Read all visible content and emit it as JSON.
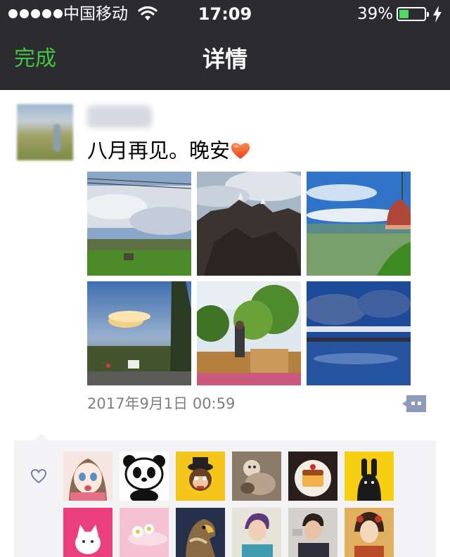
{
  "status_bar": {
    "carrier": "中国移动",
    "time": "17:09",
    "battery_percent": "39%",
    "battery_level": 0.39,
    "signal_dots": 5
  },
  "nav": {
    "done_label": "完成",
    "title": "详情"
  },
  "post": {
    "text": "八月再见。晚安",
    "emoji": "heart-emoji",
    "timestamp": "2017年9月1日 00:59",
    "photos": [
      {
        "icon": "field-landscape-photo"
      },
      {
        "icon": "rock-temple-photo"
      },
      {
        "icon": "bell-valley-photo"
      },
      {
        "icon": "sunset-road-photo"
      },
      {
        "icon": "garden-cafe-photo"
      },
      {
        "icon": "lake-reflection-photo"
      }
    ]
  },
  "likes": {
    "icon": "heart-outline-icon",
    "avatars": [
      {
        "icon": "cartoon-girl-avatar"
      },
      {
        "icon": "panda-avatar"
      },
      {
        "icon": "monkey-avatar"
      },
      {
        "icon": "baby-animals-avatar"
      },
      {
        "icon": "pudding-avatar"
      },
      {
        "icon": "black-rabbit-avatar"
      },
      {
        "icon": "white-cat-avatar"
      },
      {
        "icon": "flowers-avatar"
      },
      {
        "icon": "eagle-avatar"
      },
      {
        "icon": "boy-photo-avatar"
      },
      {
        "icon": "man-photo-avatar"
      },
      {
        "icon": "painted-lady-avatar"
      }
    ]
  },
  "colors": {
    "nav_background": "#2c2b30",
    "done_green": "#43c445",
    "battery_green": "#4cd964",
    "timestamp_gray": "#7f7f7f",
    "likes_background": "#f3f3f5",
    "comment_icon": "#8c9bb9"
  }
}
